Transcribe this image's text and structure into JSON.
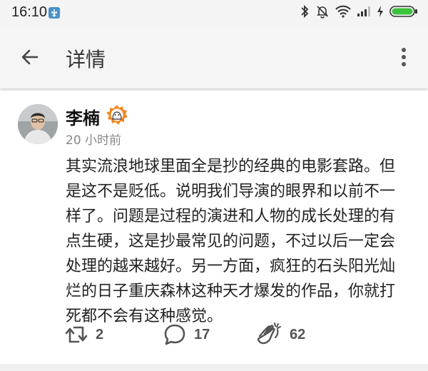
{
  "status_bar": {
    "time": "16:10"
  },
  "header": {
    "title": "详情"
  },
  "post": {
    "author": {
      "name": "李楠"
    },
    "time": "20 小时前",
    "content": "其实流浪地球里面全是抄的经典的电影套路。但是这不是贬低。说明我们导演的眼界和以前不一样了。问题是过程的演进和人物的成长处理的有点生硬，这是抄最常见的问题，不过以后一定会处理的越来越好。另一方面，疯狂的石头阳光灿烂的日子重庆森林这种天才爆发的作品，你就打死都不会有这种感觉。",
    "actions": {
      "repost_count": "2",
      "comment_count": "17",
      "clap_count": "62"
    }
  },
  "colors": {
    "status_bar_bg": "#f4f4f4",
    "app_bar_bg": "#f5f5f5",
    "icon_gray": "#555555",
    "time_gray": "#888888"
  },
  "icons": [
    "usb-debug-icon",
    "bluetooth-icon",
    "mute-icon",
    "wifi-icon",
    "signal-icon",
    "charging-icon",
    "battery-icon",
    "back-arrow-icon",
    "more-vert-icon",
    "verified-badge-icon",
    "repost-icon",
    "comment-icon",
    "clap-icon"
  ]
}
